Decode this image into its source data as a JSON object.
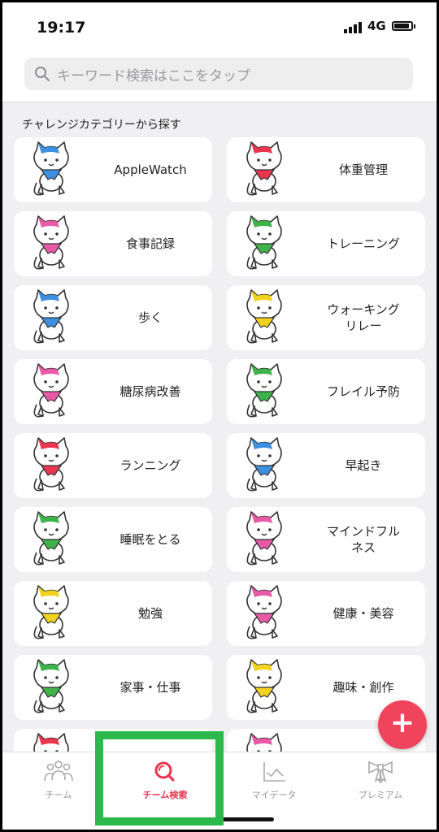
{
  "status": {
    "time": "19:17",
    "network": "4G"
  },
  "search": {
    "placeholder": "キーワード検索はここをタップ"
  },
  "section_title": "チャレンジカテゴリーから探す",
  "categories": [
    {
      "label": "AppleWatch",
      "scarf": "#3d8fe0"
    },
    {
      "label": "体重管理",
      "scarf": "#e8364f"
    },
    {
      "label": "食事記録",
      "scarf": "#e85aa8"
    },
    {
      "label": "トレーニング",
      "scarf": "#3db34a"
    },
    {
      "label": "歩く",
      "scarf": "#3d8fe0"
    },
    {
      "label": "ウォーキング\nリレー",
      "scarf": "#f2d21c"
    },
    {
      "label": "糖尿病改善",
      "scarf": "#e85aa8"
    },
    {
      "label": "フレイル予防",
      "scarf": "#3db34a"
    },
    {
      "label": "ランニング",
      "scarf": "#e8364f"
    },
    {
      "label": "早起き",
      "scarf": "#3d8fe0"
    },
    {
      "label": "睡眠をとる",
      "scarf": "#3db34a"
    },
    {
      "label": "マインドフル\nネス",
      "scarf": "#e85aa8"
    },
    {
      "label": "勉強",
      "scarf": "#f2d21c"
    },
    {
      "label": "健康・美容",
      "scarf": "#e85aa8"
    },
    {
      "label": "家事・仕事",
      "scarf": "#3db34a"
    },
    {
      "label": "趣味・創作",
      "scarf": "#f2d21c"
    },
    {
      "label": "",
      "scarf": "#e8364f"
    },
    {
      "label": "",
      "scarf": "#e85aa8"
    }
  ],
  "fab": {
    "label": "+"
  },
  "tabs": [
    {
      "label": "チーム",
      "icon": "team-icon"
    },
    {
      "label": "チーム検索",
      "icon": "search-icon"
    },
    {
      "label": "マイデータ",
      "icon": "chart-icon"
    },
    {
      "label": "プレミアム",
      "icon": "ribbon-icon"
    }
  ],
  "colors": {
    "accent": "#e8364f",
    "highlight": "#2db84b",
    "fab": "#f0435c"
  }
}
